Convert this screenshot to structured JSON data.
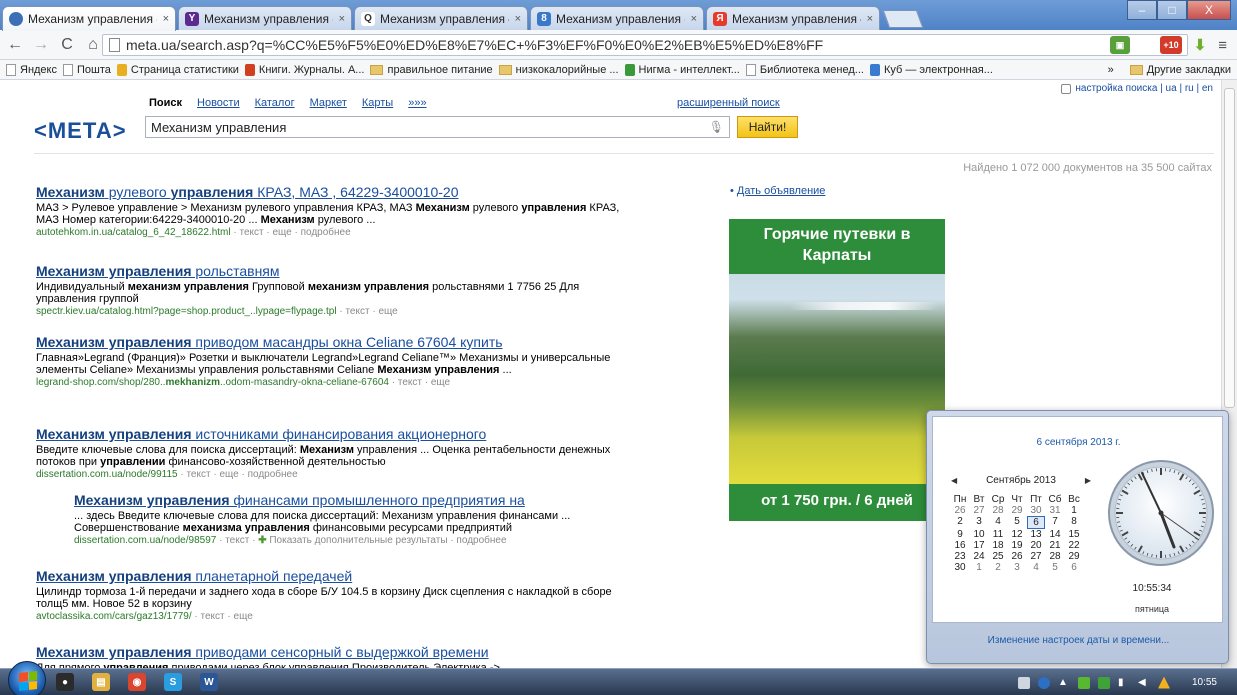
{
  "browser": {
    "tabs": [
      {
        "title": "Механизм управления - ",
        "icon": "meta-favicon",
        "color": "#3d6fb6"
      },
      {
        "title": "Механизм управления - ",
        "icon": "yahoo-favicon",
        "color": "#5c2a8e",
        "glyph": "Y"
      },
      {
        "title": "Механизм управления — ",
        "icon": "search-favicon",
        "color": "#ffffff",
        "glyph": "Q"
      },
      {
        "title": "Механизм управления - ",
        "icon": "bing-favicon",
        "color": "#3a78c8",
        "glyph": "8"
      },
      {
        "title": "Механизм управления — ",
        "icon": "yandex-favicon",
        "color": "#e53b2c",
        "glyph": "Я"
      }
    ],
    "tab_close": "×",
    "window_buttons": {
      "minimize": "–",
      "maximize": "□",
      "close": "X"
    },
    "url": "meta.ua/search.asp?q=%CC%E5%F5%E0%ED%E8%E7%EC+%F3%EF%F0%E0%E2%EB%E5%ED%E8%FF",
    "extension_badge": "+10",
    "bookmarks": [
      {
        "label": "Яндекс",
        "icon": "page-icon"
      },
      {
        "label": "Пошта",
        "icon": "page-icon"
      },
      {
        "label": "Страница статистики",
        "icon": "stats-icon"
      },
      {
        "label": "Книги. Журналы. А...",
        "icon": "books-icon"
      },
      {
        "label": "правильное питание",
        "icon": "folder-icon"
      },
      {
        "label": "низкокалорийные ...",
        "icon": "folder-icon"
      },
      {
        "label": "Нигма - интеллект...",
        "icon": "nigma-icon"
      },
      {
        "label": "Библиотека менед...",
        "icon": "page-icon"
      },
      {
        "label": "Куб — электронная...",
        "icon": "cube-icon"
      }
    ],
    "bookmarks_more": "»",
    "other_bookmarks": "Другие закладки"
  },
  "page": {
    "top_links": "настройка поиска | ua | ru | en",
    "logo": "<МЕТА>",
    "nav": [
      "Поиск",
      "Новости",
      "Каталог",
      "Маркет",
      "Карты",
      "»»»"
    ],
    "advanced_search": "расширенный поиск",
    "query": "Механизм управления",
    "find_button": "Найти!",
    "found": "Найдено 1 072 000 документов на 35 500 сайтах",
    "results": [
      {
        "title_html": "<b>Механизм</b> рулевого <b>управления</b> КРАЗ, МАЗ , 64229-3400010-20",
        "snippet_html": "МАЗ &gt; Рулевое управление &gt; Механизм рулевого управления КРАЗ, МАЗ <b>Механизм</b> рулевого <b>управления</b> КРАЗ, МАЗ Номер категории:64229-3400010-20 ... <b>Механизм</b> рулевого ...",
        "link_html": "autotehkom.in.ua/catalog_6_42_18622.html <span class='g'>· текст · еще · подробнее</span>"
      },
      {
        "title_html": "<b>Механизм управления</b> рольставням",
        "snippet_html": "Индивидуальный <b>механизм управления</b> Групповой <b>механизм управления</b> рольставнями 1 7756 25 Для управления группой",
        "link_html": "spectr.kiev.ua/catalog.html?page=shop.product_..lypage=flypage.tpl <span class='g'>· текст · еще</span>"
      },
      {
        "title_html": "<b>Механизм управления</b> приводом масандры окна Celiane 67604 купить",
        "snippet_html": "Главная»Legrand (Франция)» Розетки и выключатели Legrand»Legrand Celiane™» Механизмы и универсальные элементы Celiane» Механизмы управления рольставнями Celiane <b>Механизм управления</b> ...",
        "link_html": "legrand-shop.com/shop/280..<b>mekhanizm</b>..odom-masandry-okna-celiane-67604 <span class='g'>· текст · еще</span>"
      },
      {
        "title_html": "<b>Механизм управления</b> источниками финансирования акционерного",
        "snippet_html": "Введите ключевые слова для поиска диссертаций: <b>Механизм</b> управления ... Оценка рентабельности денежных потоков при <b>управлении</b> финансово-хозяйственной деятельностью",
        "link_html": "dissertation.com.ua/node/99115 <span class='g'>· текст · еще · подробнее</span>"
      },
      {
        "title_html": "<b>Механизм управления</b> финансами промышленного предприятия на",
        "snippet_html": "... здесь Введите ключевые слова для поиска диссертаций: Механизм управления финансами ... Совершенствование <b>механизма управления</b> финансовыми ресурсами предприятий",
        "link_html": "dissertation.com.ua/node/98597 <span class='g'>· текст · <span class='plus'>✚</span> Показать дополнительные результаты · подробнее</span>"
      },
      {
        "title_html": "<b>Механизм управления</b> планетарной передачей",
        "snippet_html": "Цилиндр тормоза 1-й передачи и заднего хода в сборе Б/У 104.5 в корзину Диск сцепления с накладкой в сборе толщ5 мм. Новое 52 в корзину",
        "link_html": "avtoclassika.com/cars/gaz13/1779/ <span class='g'>· текст · еще</span>"
      },
      {
        "title_html": "<b>Механизм управления</b> приводами сенсорный с выдержкой времени",
        "snippet_html": "Для прямого <b>управления</b> приводами через блок управления Производитель Электрика -&gt;",
        "link_html": ""
      }
    ],
    "ad_link": "Дать объявление",
    "ad_heading": "Горячие путевки в Карпаты",
    "ad_price": "от 1 750 грн. / 6 дней"
  },
  "clock_popup": {
    "date": "6 сентября 2013 г.",
    "month": "Сентябрь 2013",
    "weekdays": [
      "Пн",
      "Вт",
      "Ср",
      "Чт",
      "Пт",
      "Сб",
      "Вс"
    ],
    "days": [
      [
        "26",
        "27",
        "28",
        "29",
        "30",
        "31",
        "1"
      ],
      [
        "2",
        "3",
        "4",
        "5",
        "6",
        "7",
        "8"
      ],
      [
        "9",
        "10",
        "11",
        "12",
        "13",
        "14",
        "15"
      ],
      [
        "16",
        "17",
        "18",
        "19",
        "20",
        "21",
        "22"
      ],
      [
        "23",
        "24",
        "25",
        "26",
        "27",
        "28",
        "29"
      ],
      [
        "30",
        "1",
        "2",
        "3",
        "4",
        "5",
        "6"
      ]
    ],
    "today": "6",
    "time": "10:55:34",
    "weekday_name": "пятница",
    "change_link": "Изменение настроек даты и времени..."
  },
  "taskbar": {
    "clock": "10:55",
    "pinned": [
      {
        "name": "media-player-icon",
        "color": "#2b2b2b",
        "glyph": "●"
      },
      {
        "name": "explorer-icon",
        "color": "#e0b040",
        "glyph": "▤"
      },
      {
        "name": "chrome-icon",
        "color": "#d9452f",
        "glyph": "◉"
      },
      {
        "name": "skype-icon",
        "color": "#2a9de0",
        "glyph": "S"
      },
      {
        "name": "word-icon",
        "color": "#2b5797",
        "glyph": "W"
      }
    ]
  }
}
